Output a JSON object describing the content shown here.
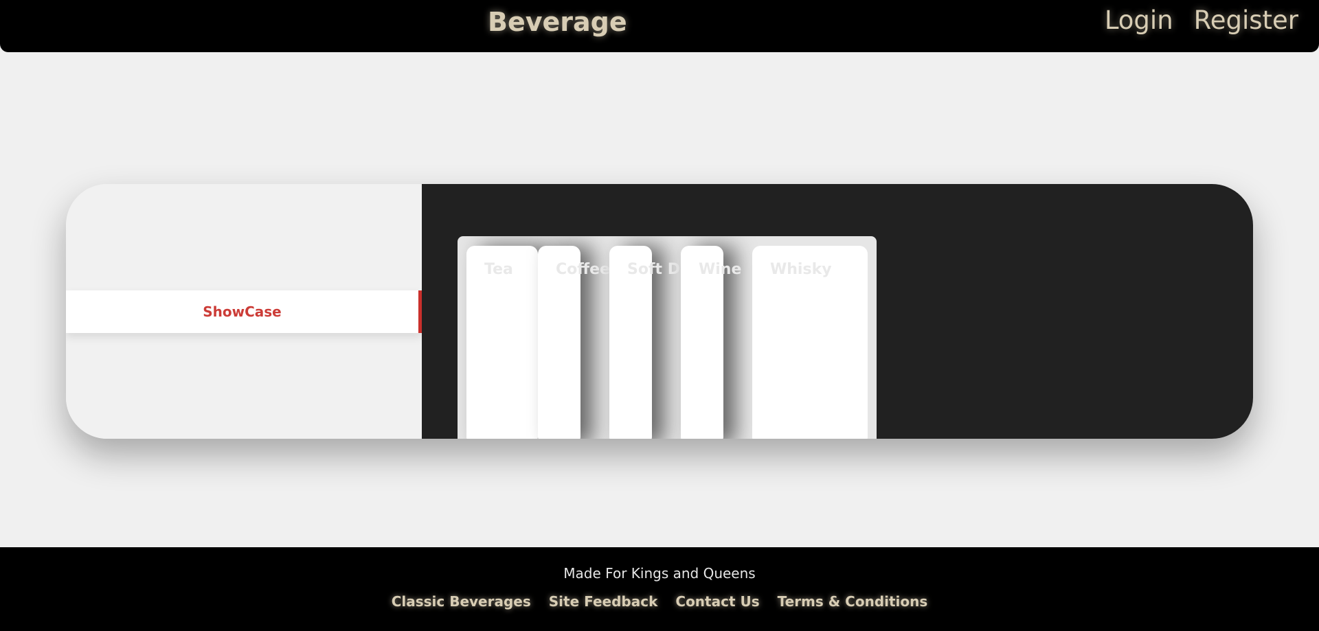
{
  "header": {
    "brand": "Beverage",
    "login_label": "Login",
    "register_label": "Register"
  },
  "sidebar": {
    "active_tab": "ShowCase"
  },
  "accordion": {
    "panels": [
      {
        "label": "Tea"
      },
      {
        "label": "Coffee"
      },
      {
        "label": "Soft Drinks"
      },
      {
        "label": "Wine"
      },
      {
        "label": "Whisky"
      }
    ]
  },
  "footer": {
    "tagline": "Made For Kings and Queens",
    "links": [
      "Classic Beverages",
      "Site Feedback",
      "Contact Us",
      "Terms & Conditions"
    ]
  },
  "colors": {
    "accent": "#cc3c37",
    "gold": "#d8cdb4",
    "dark_panel": "#212121"
  }
}
